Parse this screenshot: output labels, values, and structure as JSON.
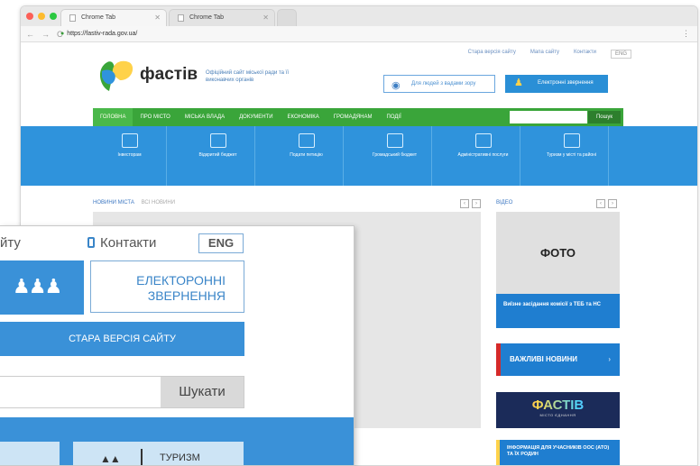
{
  "browser": {
    "tabs": [
      {
        "label": "Chrome Tab"
      },
      {
        "label": "Chrome Tab"
      }
    ],
    "url": "https://fastiv-rada.gov.ua/"
  },
  "site": {
    "top_links": [
      "Стара версія сайту",
      "Мапа сайту",
      "Контакти",
      "ENG"
    ],
    "brand": "фастів",
    "brand_sub": "Офіційний сайт міської ради та її виконавчих органів",
    "eye_button": "Для людей з вадами зору",
    "appeal_button": "Електронні звернення",
    "nav": [
      "ГОЛОВНА",
      "ПРО МІСТО",
      "МІСЬКА ВЛАДА",
      "ДОКУМЕНТИ",
      "ЕКОНОМІКА",
      "ГРОМАДЯНАМ",
      "ПОДІЇ"
    ],
    "search_button": "Пошук",
    "sections": [
      "Інвесторам",
      "Відкритий бюджет",
      "Подати петицію",
      "Громадський бюджет",
      "Адміністративні послуги",
      "Туризм у місті та районі"
    ],
    "breadcrumb": [
      "НОВИНИ МІСТА",
      "ВСІ НОВИНИ"
    ],
    "video_label": "ВІДЕО",
    "photo_label": "ФОТО",
    "news_caption": "Виїзне засідання комісії з ТЕБ та НС",
    "important_news": "ВАЖЛИВІ НОВИНИ",
    "fastiv_banner": "ФАСТІВ",
    "fastiv_banner_sub": "МІСТО ЄДНАННЯ",
    "ato_text": "ІНФОРМАЦІЯ ДЛЯ УЧАСНИКІВ ООС (АТО) ТА ЇХ РОДИН"
  },
  "overlay": {
    "site_link": "йту",
    "contacts": "Контакти",
    "eng": "ENG",
    "appeal": "ЕЛЕКТОРОННІ ЗВЕРНЕННЯ",
    "old_version": "СТАРА ВЕРСІЯ САЙТУ",
    "search_button": "Шукати",
    "tourism": "ТУРИЗМ"
  }
}
